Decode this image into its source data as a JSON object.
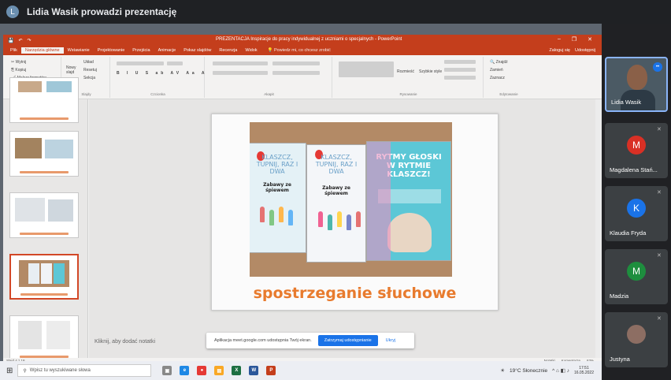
{
  "meet": {
    "presenter_initial": "L",
    "presenting_title": "Lidia Wasik prowadzi prezentację",
    "share_notice": "Aplikacja meet.google.com udostępnia Twój ekran.",
    "stop_sharing": "Zatrzymaj udostępnianie",
    "hide": "Ukryj"
  },
  "ppt": {
    "quick_title": "PREZENTACJA Inspiracje do pracy indywidualnej z uczniami o specjalnych - PowerPoint",
    "tabs": [
      "Plik",
      "Narzędzia główne",
      "Wstawianie",
      "Projektowanie",
      "Przejścia",
      "Animacje",
      "Pokaz slajdów",
      "Recenzja",
      "Widok"
    ],
    "active_tab": 1,
    "tell_me": "Powiedz mi, co chcesz zrobić",
    "sign_in": "Zaloguj się",
    "share": "Udostępnij",
    "clipboard": {
      "cut": "Wytnij",
      "copy": "Kopiuj",
      "painter": "Malarz formatów",
      "group": "Schowek"
    },
    "slides_group": {
      "new_slide": "Nowy slajd",
      "layout": "Układ",
      "reset": "Resetuj",
      "section": "Sekcja",
      "group": "Slajdy"
    },
    "font_group": "Czcionka",
    "paragraph_group": "Akapit",
    "drawing": {
      "arrange": "Rozmieść",
      "styles": "Szybkie style",
      "group": "Rysowanie"
    },
    "editing": {
      "find": "Znajdź",
      "replace": "Zamień",
      "select": "Zaznacz",
      "group": "Edytowanie"
    },
    "notes_placeholder": "Kliknij, aby dodać notatki",
    "status_left": "Slajd 4 z 18",
    "status_right": {
      "notes": "Notatki",
      "comments": "Komentarze",
      "zoom": "63%"
    },
    "slide_caption": "spostrzeganie słuchowe"
  },
  "books": [
    {
      "title": "KLASZCZ, TUPNIJ, RAZ I DWA",
      "subtitle": "Zabawy ze śpiewem",
      "color": "#e4f1f6"
    },
    {
      "title": "KLASZCZ, TUPNIJ, RAZ I DWA",
      "subtitle": "Zabawy ze śpiewem",
      "color": "#f4f6f9"
    },
    {
      "title": "RYTMY GŁOSKI W RYTMIE KLASZCZ!",
      "subtitle": "",
      "color": "#5cc7d6"
    }
  ],
  "taskbar": {
    "search": "Wpisz tu wyszukiwane słowa",
    "weather": "19°C Słonecznie",
    "time": "17:51",
    "date": "16.05.2022"
  },
  "participants": [
    {
      "name": "Lidia Wasik",
      "initial": "",
      "color": "",
      "video": true
    },
    {
      "name": "Magdalena Stań...",
      "initial": "M",
      "color": "#d93025",
      "video": false
    },
    {
      "name": "Klaudia Fryda",
      "initial": "K",
      "color": "#1a73e8",
      "video": false
    },
    {
      "name": "Madzia",
      "initial": "M",
      "color": "#1e8e3e",
      "video": false
    },
    {
      "name": "Justyna",
      "initial": "",
      "color": "#8d6e63",
      "video": false
    }
  ]
}
